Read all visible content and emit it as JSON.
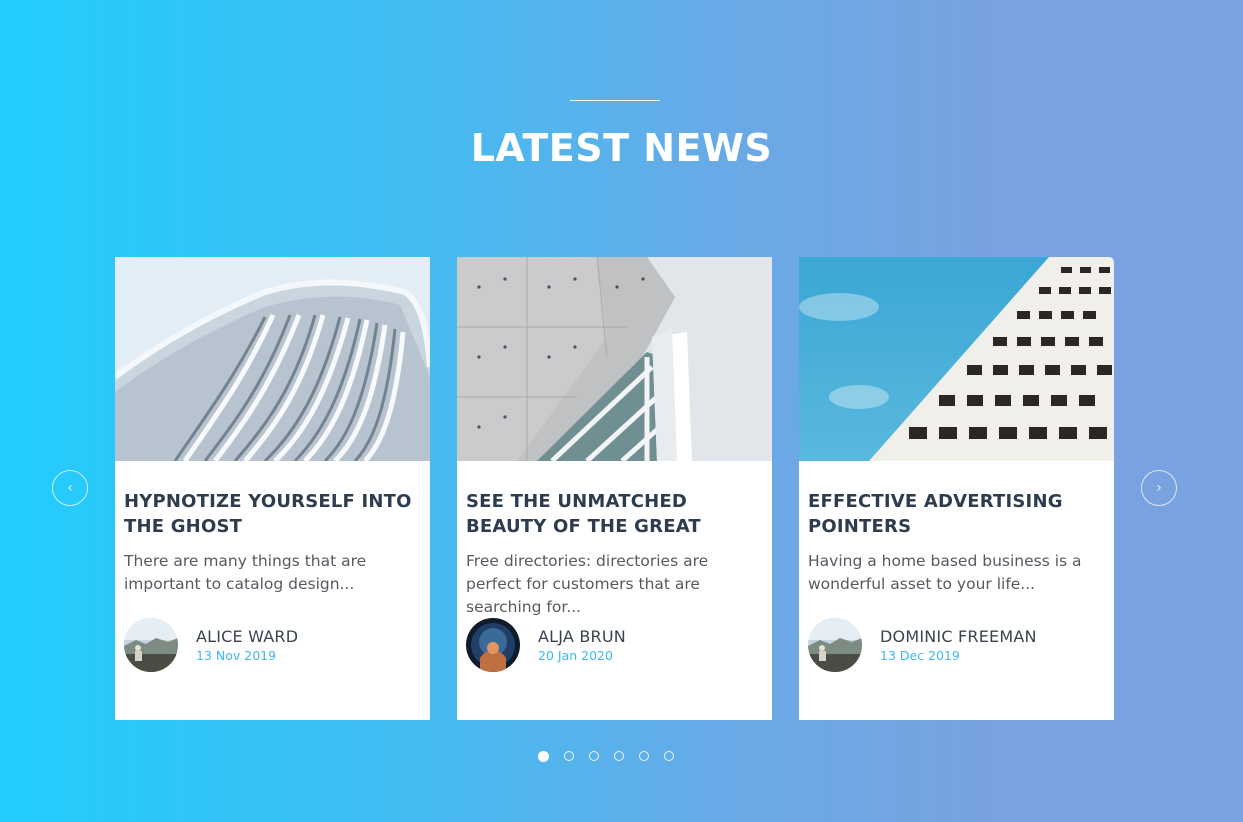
{
  "section": {
    "title": "LATEST NEWS"
  },
  "carousel": {
    "prev_icon": "chevron-left-icon",
    "prev_glyph": "‹",
    "next_icon": "chevron-right-icon",
    "next_glyph": "›",
    "active_index": 0,
    "dot_count": 6
  },
  "articles": [
    {
      "title": "HYPNOTIZE YOURSELF INTO THE GHOST",
      "excerpt": "There are many things that are important to catalog design...",
      "author": "ALICE WARD",
      "date": "13 Nov 2019"
    },
    {
      "title": "SEE THE UNMATCHED BEAUTY OF THE GREAT",
      "excerpt": "Free directories: directories are perfect for customers that are searching for...",
      "author": "ALJA BRUN",
      "date": "20 Jan 2020"
    },
    {
      "title": "EFFECTIVE ADVERTISING POINTERS",
      "excerpt": "Having a home based business is a wonderful asset to your life...",
      "author": "DOMINIC FREEMAN",
      "date": "13 Dec 2019"
    }
  ],
  "colors": {
    "gradient_start": "#21cdfd",
    "gradient_end": "#78a2e0",
    "heading": "#2d3c4f",
    "date": "#3fb9ef"
  }
}
